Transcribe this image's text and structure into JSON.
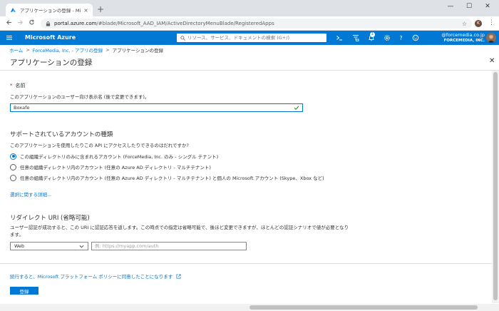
{
  "browser": {
    "tab_title": "アプリケーションの登録 - Microsoft A",
    "url_host": "portal.azure.com",
    "url_path": "/#blade/Microsoft_AAD_IAM/ActiveDirectoryMenuBlade/RegisteredApps",
    "profile_initial": "K",
    "new_tab": "+",
    "tab_close": "×",
    "win_min": "—",
    "win_max": "☐",
    "win_close": "✕"
  },
  "azure_header": {
    "brand": "Microsoft Azure",
    "search_placeholder": "リソース、サービス、ドキュメントの検索 (G+/)",
    "notification_count": "1",
    "account_email": "@forcemedia.co.jp",
    "account_org": "FORCEMEDIA, INC."
  },
  "breadcrumb": {
    "home": "ホーム",
    "tenant": "ForceMedia, Inc. - アプリの登録",
    "current": "アプリケーションの登録",
    "separator": ">"
  },
  "blade": {
    "title": "アプリケーションの登録",
    "close": "✕"
  },
  "form": {
    "name_required_mark": "*",
    "name_label": "名前",
    "name_description": "このアプリケーションのユーザー向け表示名 (後で変更できます)。",
    "name_value": "Boxafe",
    "account_types_title": "サポートされているアカウントの種類",
    "account_types_question": "このアプリケーションを使用したりこの API にアクセスしたりできるのはだれですか?",
    "account_options": [
      {
        "label": "この組織ディレクトリのみに含まれるアカウント (ForceMedia, Inc. のみ - シングル テナント)",
        "selected": true
      },
      {
        "label": "任意の組織ディレクトリ内のアカウント (任意の Azure AD ディレクトリ - マルチテナント)",
        "selected": false
      },
      {
        "label": "任意の組織ディレクトリ内のアカウント (任意の Azure AD ディレクトリ - マルチテナント) と個人の Microsoft アカウント (Skype、Xbox など)",
        "selected": false
      }
    ],
    "help_link": "選択に関する詳細...",
    "redirect_title": "リダイレクト URI (省略可能)",
    "redirect_desc_line1": "ユーザー認証が成功すると、この URI に認証応答を返します。この時点での指定は省略可能で、後ほど変更できますが、ほとんどの認証シナリオで値が必要となり",
    "redirect_desc_line2": "ます。",
    "platform_value": "Web",
    "redirect_placeholder": "例: https://myapp.com/auth",
    "policy_link": "続行すると、Microsoft プラットフォーム ポリシーに同意したことになります",
    "register_button": "登録"
  },
  "colors": {
    "azure_blue": "#0078d4",
    "required_red": "#a4262c"
  }
}
